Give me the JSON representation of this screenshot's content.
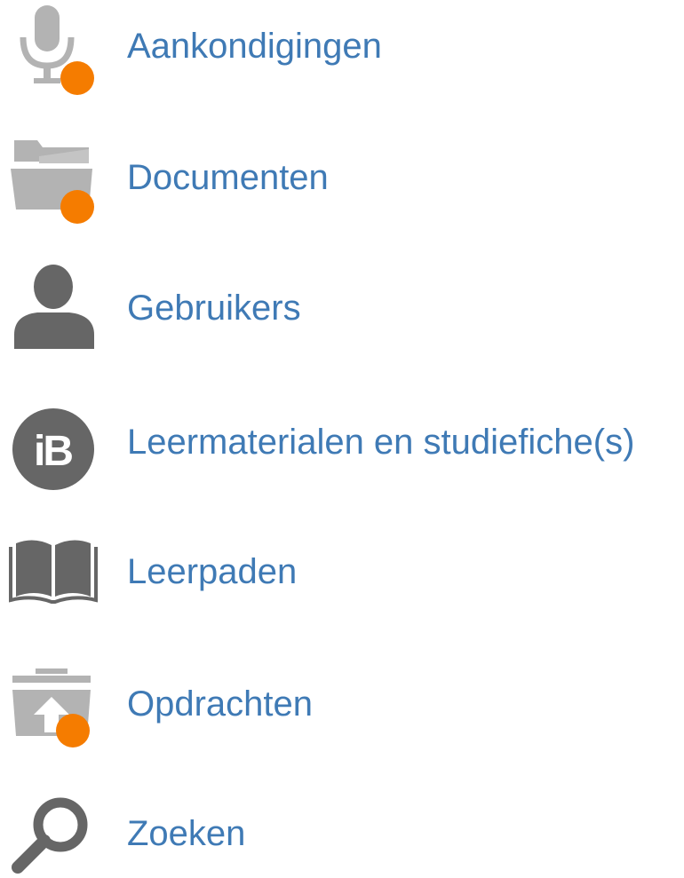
{
  "menu": {
    "items": [
      {
        "label": "Aankondigingen",
        "icon": "microphone-icon",
        "has_notification": true
      },
      {
        "label": "Documenten",
        "icon": "folder-icon",
        "has_notification": true
      },
      {
        "label": "Gebruikers",
        "icon": "user-icon",
        "has_notification": false
      },
      {
        "label": "Leermaterialen en studiefiche(s)",
        "icon": "ib-badge-icon",
        "badge_text": "iB",
        "has_notification": false
      },
      {
        "label": "Leerpaden",
        "icon": "book-icon",
        "has_notification": false
      },
      {
        "label": "Opdrachten",
        "icon": "upload-box-icon",
        "has_notification": true
      },
      {
        "label": "Zoeken",
        "icon": "search-icon",
        "has_notification": false
      }
    ]
  },
  "colors": {
    "label": "#3f7ab5",
    "icon_light": "#b3b3b3",
    "icon_dark": "#666666",
    "notification": "#f57c00"
  }
}
